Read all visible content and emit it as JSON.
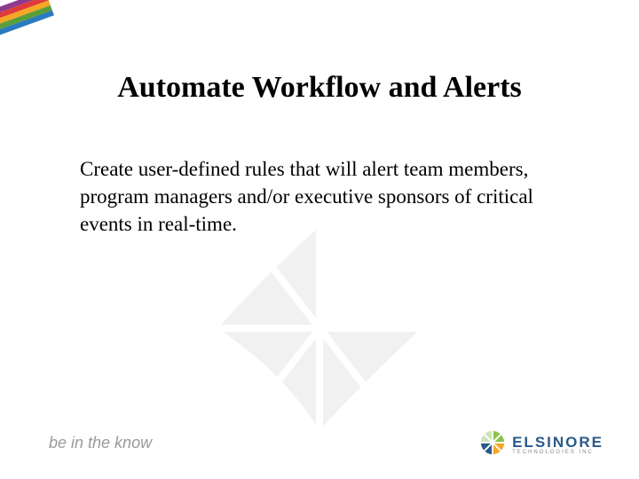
{
  "slide": {
    "title": "Automate Workflow and Alerts",
    "body": "Create user-defined rules that will alert team members, program managers and/or executive sponsors of critical events in real-time.",
    "tagline": "be in the know"
  },
  "brand": {
    "name": "ELSINORE",
    "subtitle": "TECHNOLOGIES INC",
    "colors": {
      "primary": "#2a5a8a",
      "accentGreen": "#8bc34a",
      "accentOrange": "#f5a623"
    }
  }
}
